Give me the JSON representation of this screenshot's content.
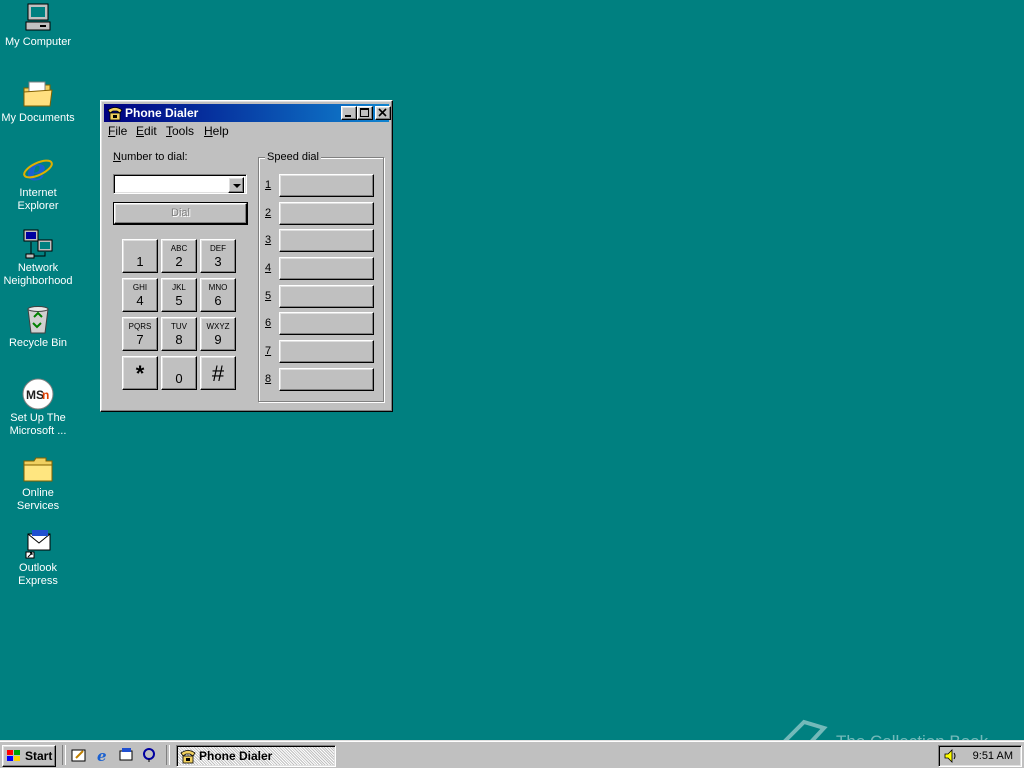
{
  "desktop": {
    "icons": [
      {
        "label": "My Computer"
      },
      {
        "label": "My Documents"
      },
      {
        "label1": "Internet",
        "label2": "Explorer"
      },
      {
        "label1": "Network",
        "label2": "Neighborhood"
      },
      {
        "label": "Recycle Bin"
      },
      {
        "label1": "Set Up The",
        "label2": "Microsoft ..."
      },
      {
        "label1": "Online",
        "label2": "Services"
      },
      {
        "label1": "Outlook",
        "label2": "Express"
      }
    ]
  },
  "window": {
    "title": "Phone Dialer",
    "menu": {
      "file": {
        "hot": "F",
        "rest": "ile"
      },
      "edit": {
        "hot": "E",
        "rest": "dit"
      },
      "tools": {
        "hot": "T",
        "rest": "ools"
      },
      "help": {
        "hot": "H",
        "rest": "elp"
      }
    },
    "number_label_hot": "N",
    "number_label_rest": "umber to dial:",
    "number_value": "",
    "dial_label": "Dial",
    "keypad": [
      {
        "letters": "",
        "digit": "1"
      },
      {
        "letters": "ABC",
        "digit": "2"
      },
      {
        "letters": "DEF",
        "digit": "3"
      },
      {
        "letters": "GHI",
        "digit": "4"
      },
      {
        "letters": "JKL",
        "digit": "5"
      },
      {
        "letters": "MNO",
        "digit": "6"
      },
      {
        "letters": "PQRS",
        "digit": "7"
      },
      {
        "letters": "TUV",
        "digit": "8"
      },
      {
        "letters": "WXYZ",
        "digit": "9"
      },
      {
        "symbol": "*"
      },
      {
        "letters": "",
        "digit": "0"
      },
      {
        "symbol": "#"
      }
    ],
    "speed_dial": {
      "legend": "Speed dial",
      "entries": [
        {
          "num": "1",
          "label": ""
        },
        {
          "num": "2",
          "label": ""
        },
        {
          "num": "3",
          "label": ""
        },
        {
          "num": "4",
          "label": ""
        },
        {
          "num": "5",
          "label": ""
        },
        {
          "num": "6",
          "label": ""
        },
        {
          "num": "7",
          "label": ""
        },
        {
          "num": "8",
          "label": ""
        }
      ]
    }
  },
  "taskbar": {
    "start_label": "Start",
    "task_label": "Phone Dialer",
    "clock": "9:51 AM"
  },
  "watermark": {
    "text": "The Collection Book"
  },
  "colors": {
    "desktop": "#008080",
    "titlebar": "#000080",
    "face": "#c0c0c0"
  }
}
